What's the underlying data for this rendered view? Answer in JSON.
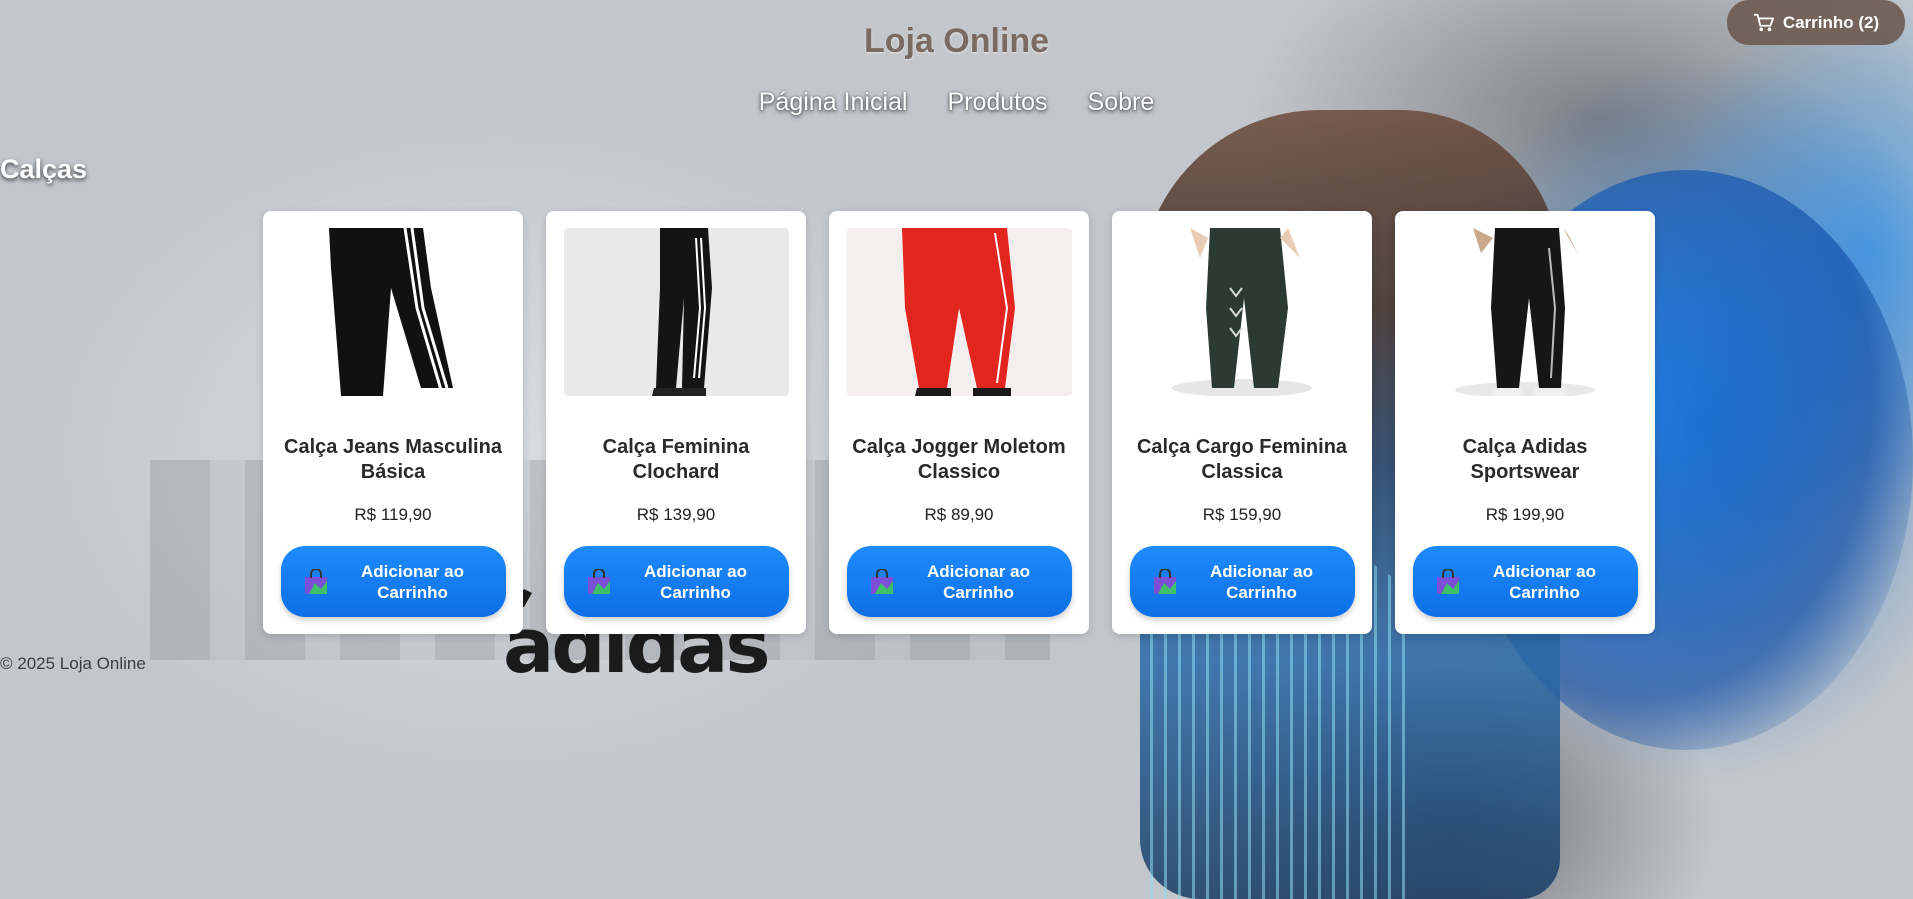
{
  "header": {
    "site_title": "Loja Online",
    "nav": [
      "Página Inicial",
      "Produtos",
      "Sobre"
    ],
    "cart_label": "Carrinho (2)",
    "cart_icon": "cart-icon"
  },
  "section": {
    "title": "Calças"
  },
  "products": [
    {
      "name": "Calça Jeans Masculina Básica",
      "price": "R$ 119,90",
      "button": "Adicionar ao Carrinho",
      "color": "#111111"
    },
    {
      "name": "Calça Feminina Clochard",
      "price": "R$ 139,90",
      "button": "Adicionar ao Carrinho",
      "color": "#141414"
    },
    {
      "name": "Calça Jogger Moletom Classico",
      "price": "R$ 89,90",
      "button": "Adicionar ao Carrinho",
      "color": "#e3251f"
    },
    {
      "name": "Calça Cargo Feminina Classica",
      "price": "R$ 159,90",
      "button": "Adicionar ao Carrinho",
      "color": "#2c3a34"
    },
    {
      "name": "Calça Adidas Sportswear",
      "price": "R$ 199,90",
      "button": "Adicionar ao Carrinho",
      "color": "#161616"
    }
  ],
  "background_logo": "adidas",
  "footer": {
    "copyright": "© 2025 Loja Online"
  },
  "colors": {
    "button": "#1e8bff",
    "cart_bg": "#6e5c52",
    "title": "#7a6a62"
  }
}
